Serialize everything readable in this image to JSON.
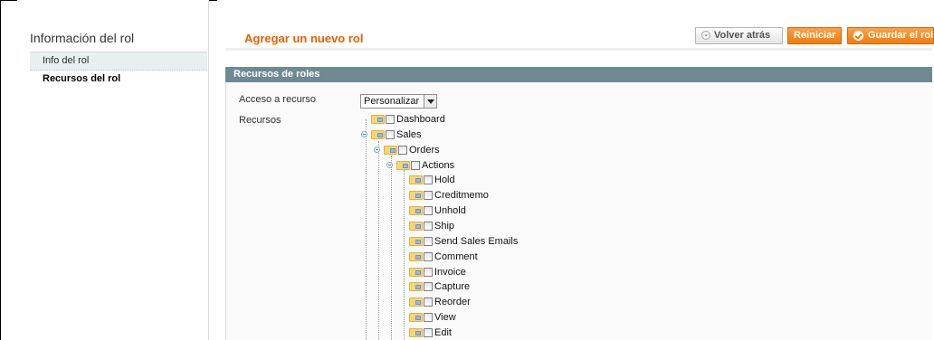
{
  "sidebar": {
    "title": "Información del rol",
    "items": [
      {
        "label": "Info del rol"
      },
      {
        "label": "Recursos del rol"
      }
    ]
  },
  "header": {
    "title": "Agregar un nuevo rol",
    "buttons": {
      "back": "Volver atrás",
      "reset": "Reiniciar",
      "save": "Guardar el rol"
    }
  },
  "section": {
    "title": "Recursos de roles",
    "access_label": "Acceso a recurso",
    "access_value": "Personalizar",
    "resources_label": "Recursos"
  },
  "tree": [
    {
      "label": "Dashboard",
      "level": 0,
      "expanded": false
    },
    {
      "label": "Sales",
      "level": 0,
      "expanded": true
    },
    {
      "label": "Orders",
      "level": 1,
      "expanded": true
    },
    {
      "label": "Actions",
      "level": 2,
      "expanded": true
    },
    {
      "label": "Hold",
      "level": 3
    },
    {
      "label": "Creditmemo",
      "level": 3
    },
    {
      "label": "Unhold",
      "level": 3
    },
    {
      "label": "Ship",
      "level": 3
    },
    {
      "label": "Send Sales Emails",
      "level": 3
    },
    {
      "label": "Comment",
      "level": 3
    },
    {
      "label": "Invoice",
      "level": 3
    },
    {
      "label": "Capture",
      "level": 3
    },
    {
      "label": "Reorder",
      "level": 3
    },
    {
      "label": "View",
      "level": 3
    },
    {
      "label": "Edit",
      "level": 3
    }
  ],
  "colors": {
    "accent": "#eb5e00",
    "button_orange": "#f07d0a",
    "section_header": "#6f8992"
  }
}
